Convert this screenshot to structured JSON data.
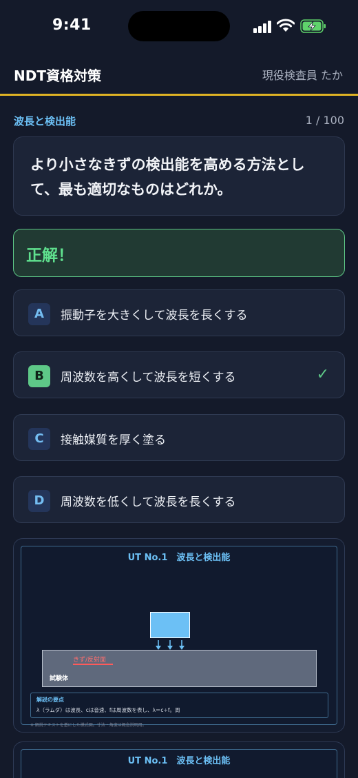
{
  "status_bar": {
    "time": "9:41"
  },
  "header": {
    "title": "NDT資格対策",
    "user": "現役検査員 たか"
  },
  "quiz": {
    "category": "波長と検出能",
    "progress": "1 / 100",
    "question": "より小さなきずの検出能を高める方法として、最も適切なものはどれか。",
    "result": "正解！"
  },
  "options": [
    {
      "letter": "A",
      "text": "振動子を大きくして波長を長くする",
      "correct": false
    },
    {
      "letter": "B",
      "text": "周波数を高くして波長を短くする",
      "correct": true,
      "mark": "✓"
    },
    {
      "letter": "C",
      "text": "接触媒質を厚く塗る",
      "correct": false
    },
    {
      "letter": "D",
      "text": "周波数を低くして波長を長くする",
      "correct": false
    }
  ],
  "diagram": {
    "title": "UT No.1　波長と検出能",
    "flaw_label": "きず/反射面",
    "specimen_label": "試験体",
    "notes_title": "解説の要点",
    "notes_text": "λ（ラムダ）は波長、cは音速、fは周波数を表し、λ＝c÷f。周",
    "footnote": "※ 解説テキストを基にした模式図。寸法・角度は概念説明用。"
  },
  "diagram2": {
    "title": "UT No.1　波長と検出能"
  },
  "colors": {
    "background": "#141a2a",
    "accent_yellow": "#e0b324",
    "accent_blue": "#6cc0f5",
    "correct_green": "#5ec887"
  }
}
